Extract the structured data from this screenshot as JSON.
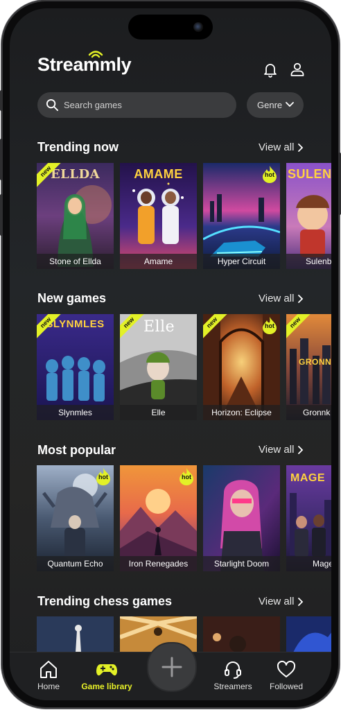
{
  "app": {
    "logo_text": "Streammly"
  },
  "search": {
    "placeholder": "Search games"
  },
  "genre": {
    "label": "Genre"
  },
  "badges": {
    "new": "new",
    "hot": "hot"
  },
  "sections": [
    {
      "title": "Trending now",
      "view_all": "View all",
      "cards": [
        "Stone of Ellda",
        "Amame",
        "Hyper Circuit",
        "Sulenb"
      ]
    },
    {
      "title": "New games",
      "view_all": "View all",
      "cards": [
        "Slynmles",
        "Elle",
        "Horizon: Eclipse",
        "Gronnk"
      ]
    },
    {
      "title": "Most popular",
      "view_all": "View all",
      "cards": [
        "Quantum Echo",
        "Iron Renegades",
        "Starlight Doom",
        "Mage"
      ]
    },
    {
      "title": "Trending chess games",
      "view_all": "View all"
    }
  ],
  "art_titles": {
    "amame": "AMAME",
    "sulen": "SULEN",
    "slynmles": "SLYNMLES",
    "elle": "Elle",
    "gronnk": "GRONNK",
    "mage": "MAGE",
    "ellda": "ELLDA"
  },
  "tabbar": {
    "home": "Home",
    "library": "Game library",
    "streamers": "Streamers",
    "followed": "Followed"
  },
  "colors": {
    "accent": "#e3f127",
    "background": "#1f2022"
  }
}
